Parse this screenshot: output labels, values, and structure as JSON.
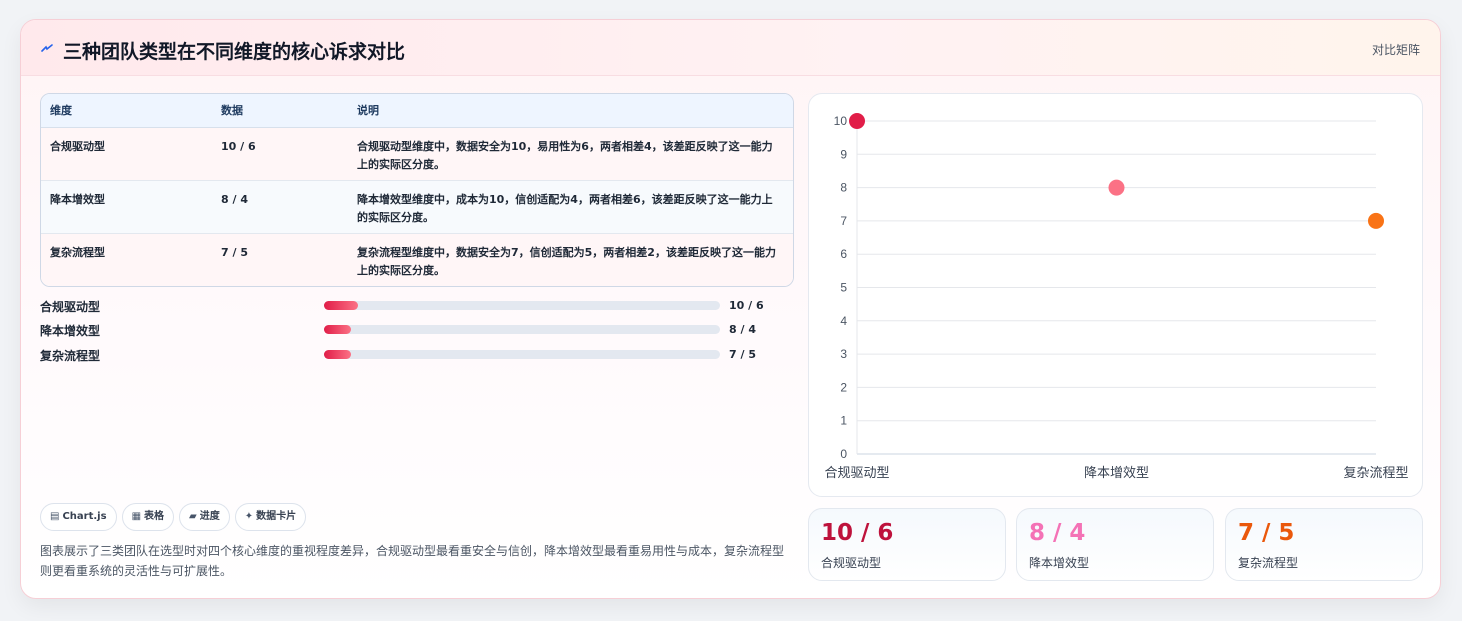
{
  "header": {
    "title": "三种团队类型在不同维度的核心诉求对比",
    "badge": "对比矩阵",
    "icon": "lightning-icon",
    "accent_color": "#2563eb"
  },
  "table": {
    "headers": [
      "维度",
      "数据",
      "说明"
    ],
    "rows": [
      {
        "dimension": "合规驱动型",
        "data": "10 / 6",
        "note": "合规驱动型维度中，数据安全为10，易用性为6，两者相差4，该差距反映了这一能力上的实际区分度。"
      },
      {
        "dimension": "降本增效型",
        "data": "8 / 4",
        "note": "降本增效型维度中，成本为10，信创适配为4，两者相差6，该差距反映了这一能力上的实际区分度。"
      },
      {
        "dimension": "复杂流程型",
        "data": "7 / 5",
        "note": "复杂流程型维度中，数据安全为7，信创适配为5，两者相差2，该差距反映了这一能力上的实际区分度。"
      }
    ]
  },
  "progress": [
    {
      "label": "合规驱动型",
      "value_text": "10 / 6",
      "fill": 0.085
    },
    {
      "label": "降本增效型",
      "value_text": "8 / 4",
      "fill": 0.068
    },
    {
      "label": "复杂流程型",
      "value_text": "7 / 5",
      "fill": 0.068
    }
  ],
  "chips": [
    {
      "icon": "chart-icon",
      "glyph": "▤",
      "label": "Chart.js"
    },
    {
      "icon": "table-icon",
      "glyph": "▦",
      "label": "表格"
    },
    {
      "icon": "progress-icon",
      "glyph": "▰",
      "label": "进度"
    },
    {
      "icon": "sparkle-icon",
      "glyph": "✦",
      "label": "数据卡片"
    }
  ],
  "description": "图表展示了三类团队在选型时对四个核心维度的重视程度差异，合规驱动型最看重安全与信创，降本增效型最看重易用性与成本，复杂流程型则更看重系统的灵活性与可扩展性。",
  "chart_data": {
    "type": "scatter",
    "categories": [
      "合规驱动型",
      "降本增效型",
      "复杂流程型"
    ],
    "values": [
      10,
      8,
      7
    ],
    "colors": [
      "#e11d48",
      "#fb7185",
      "#f97316"
    ],
    "ylim": [
      0,
      10
    ],
    "yticks": [
      0,
      1,
      2,
      3,
      4,
      5,
      6,
      7,
      8,
      9,
      10
    ],
    "grid": true,
    "title": "",
    "xlabel": "",
    "ylabel": ""
  },
  "stats": [
    {
      "value": "10 / 6",
      "label": "合规驱动型",
      "color": "#be123c"
    },
    {
      "value": "8 / 4",
      "label": "降本增效型",
      "color": "#f472b6"
    },
    {
      "value": "7 / 5",
      "label": "复杂流程型",
      "color": "#ea580c"
    }
  ]
}
